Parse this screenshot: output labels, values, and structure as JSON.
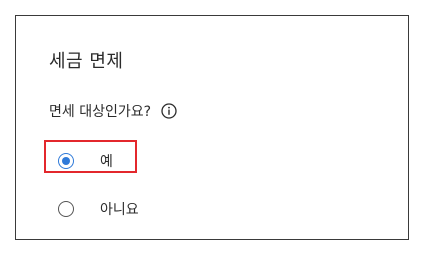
{
  "dialog": {
    "title": "세금 면제",
    "question": "면세 대상인가요?",
    "info_icon": "info-icon"
  },
  "options": [
    {
      "label": "예",
      "selected": true
    },
    {
      "label": "아니요",
      "selected": false
    }
  ],
  "colors": {
    "accent": "#2f7ad9",
    "highlight": "#e3272c"
  }
}
